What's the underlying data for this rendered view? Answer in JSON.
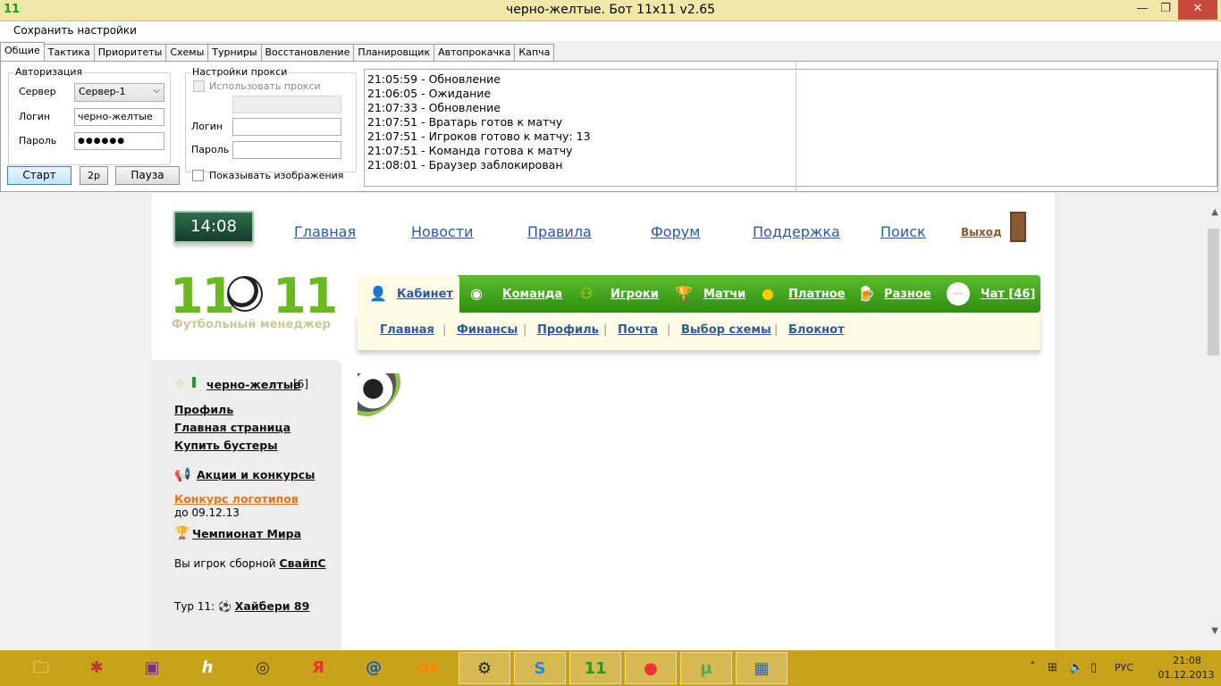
{
  "window": {
    "icon_text": "11",
    "title": "черно-желтые.  Бот 11x11 v2.65",
    "min_glyph": "—",
    "max_glyph": "❐",
    "close_glyph": "✕"
  },
  "menu": {
    "save_settings": "Сохранить настройки"
  },
  "tabs": [
    "Общие",
    "Тактика",
    "Приоритеты",
    "Схемы",
    "Турниры",
    "Восстановление",
    "Планировщик",
    "Автопрокачка",
    "Капча"
  ],
  "auth": {
    "title": "Авторизация",
    "server_label": "Сервер",
    "server_value": "Сервер-1",
    "login_label": "Логин",
    "login_value": "черно-желтые",
    "password_label": "Пароль",
    "password_value": "●●●●●●"
  },
  "proxy": {
    "title": "Настройки прокси",
    "use_proxy": "Использовать прокси",
    "login_label": "Логин",
    "password_label": "Пароль"
  },
  "buttons": {
    "start": "Старт",
    "two_p": "2р",
    "pause": "Пауза"
  },
  "show_images": "Показывать изображения",
  "log": [
    "21:05:59 - Обновление",
    "21:06:05 - Ожидание",
    "21:07:33 - Обновление",
    "21:07:51 - Вратарь готов к матчу",
    "21:07:51 - Игроков готово к матчу: 13",
    "21:07:51 - Команда готова к матчу",
    "21:08:01 - Браузер заблокирован"
  ],
  "site": {
    "clock": "14:08",
    "top_links": [
      "Главная",
      "Новости",
      "Правила",
      "Форум",
      "Поддержка",
      "Поиск"
    ],
    "exit": "Выход",
    "logo_left": "11",
    "logo_right": "11",
    "logo_sub": "Футбольный менеджер",
    "main_nav": [
      "Кабинет",
      "Команда",
      "Игроки",
      "Матчи",
      "Платное",
      "Разное",
      "Чат [46]"
    ],
    "sub_nav": [
      "Главная",
      "Финансы",
      "Профиль",
      "Почта",
      "Выбор схемы",
      "Блокнот"
    ],
    "sidebar": {
      "team_name": "черно-желтые",
      "team_level": "[6]",
      "profile": "Профиль",
      "home_page": "Главная страница",
      "buy_boosters": "Купить бустеры",
      "promos": "Акции и конкурсы",
      "contest": "Конкурс логотипов",
      "contest_until": "до 09.12.13",
      "world_cup": "Чемпионат Мира",
      "national_prefix": "Вы игрок сборной",
      "national_team": "СвайпС",
      "round_prefix": "Тур 11:",
      "round_opponent": "Хайбери 89"
    }
  },
  "tray": {
    "lang": "РУС",
    "time": "21:08",
    "date": "01.12.2013"
  },
  "colors": {
    "titlebar": "#f0e8a8",
    "taskbar": "#c8a21a",
    "site_green": "#3fa11a",
    "link_blue": "#2e5a9e"
  }
}
